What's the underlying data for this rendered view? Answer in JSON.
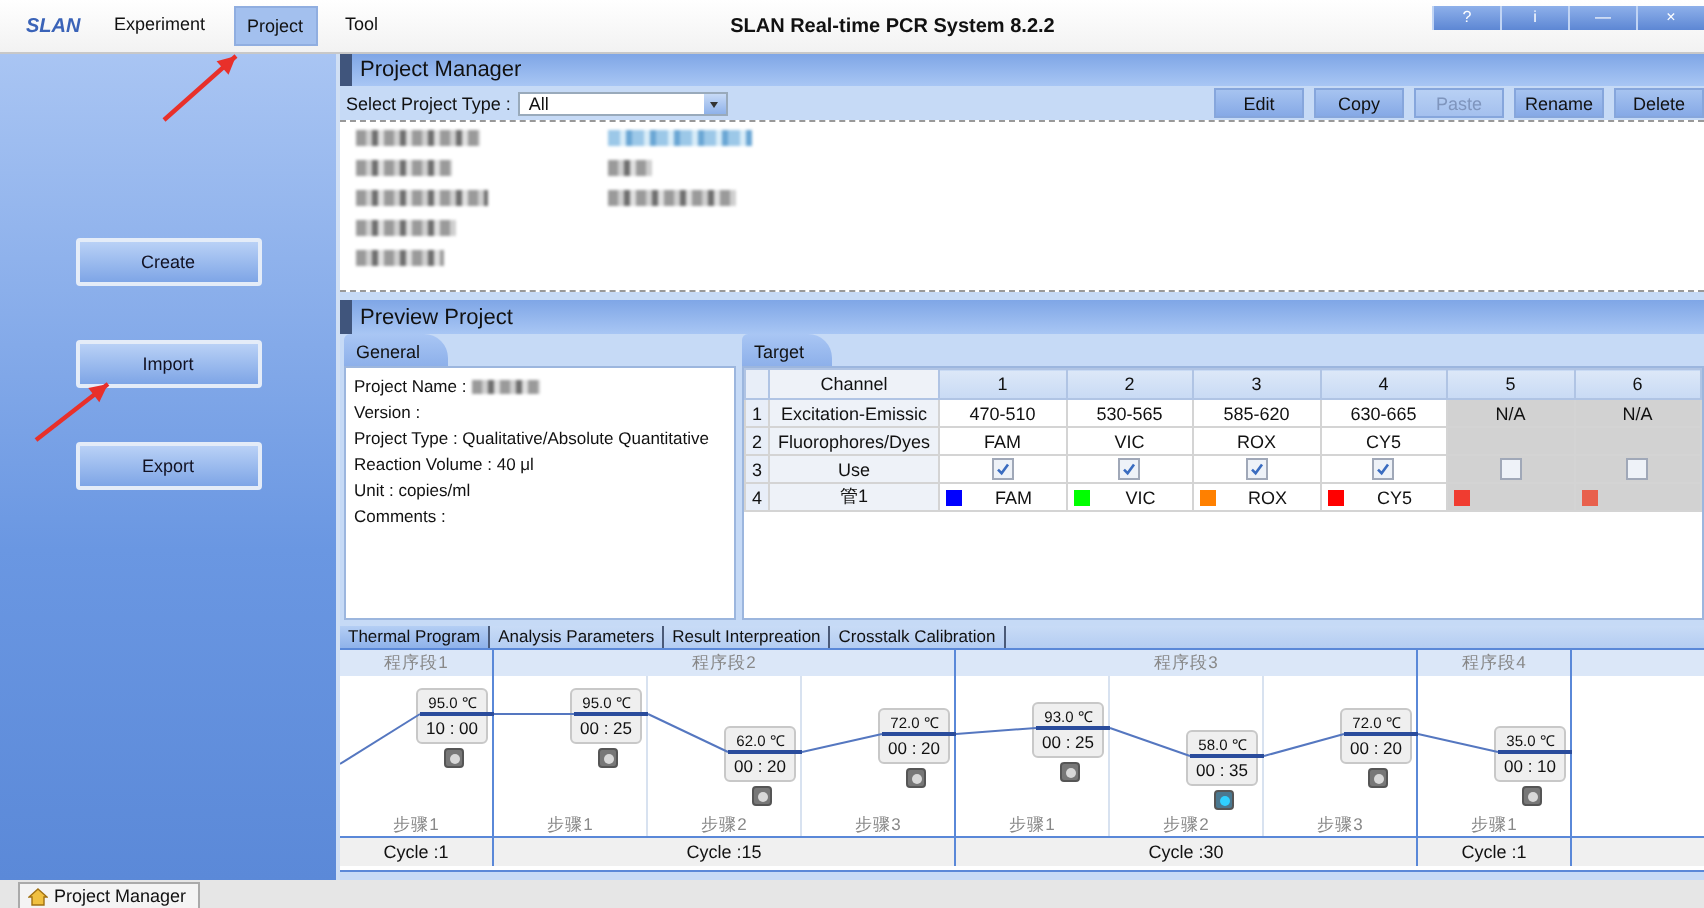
{
  "app": {
    "logo": "SLAN",
    "title": "SLAN Real-time PCR System 8.2.2"
  },
  "menu": [
    {
      "label": "Experiment",
      "selected": false
    },
    {
      "label": "Project",
      "selected": true
    },
    {
      "label": "Tool",
      "selected": false
    }
  ],
  "window_buttons": [
    "?",
    "i",
    "—",
    "×"
  ],
  "sidebar": {
    "buttons": [
      "Create",
      "Import",
      "Export"
    ]
  },
  "project_manager": {
    "title": "Project Manager",
    "type_label": "Select Project Type :",
    "type_value": "All",
    "actions": [
      {
        "label": "Edit",
        "disabled": false
      },
      {
        "label": "Copy",
        "disabled": false
      },
      {
        "label": "Paste",
        "disabled": true
      },
      {
        "label": "Rename",
        "disabled": false
      },
      {
        "label": "Delete",
        "disabled": false
      }
    ],
    "project_list": {
      "kind": "blurred"
    }
  },
  "preview": {
    "title": "Preview Project",
    "general": {
      "tab": "General",
      "project_name": {
        "kind": "blurred"
      },
      "lines": [
        "Project Name :",
        "Version :",
        "Project Type : Qualitative/Absolute Quantitative",
        "Reaction Volume : 40 μl",
        "Unit : copies/ml",
        "Comments :"
      ]
    },
    "target": {
      "tab": "Target",
      "channel_header": "Channel",
      "columns": [
        {
          "label": "1",
          "disabled": false
        },
        {
          "label": "2",
          "disabled": false
        },
        {
          "label": "3",
          "disabled": false
        },
        {
          "label": "4",
          "disabled": false
        },
        {
          "label": "5",
          "disabled": true
        },
        {
          "label": "6",
          "disabled": true
        }
      ],
      "rows": [
        {
          "index": "1",
          "label": "Excitation-Emissic",
          "kind": "text",
          "cells": [
            "470-510",
            "530-565",
            "585-620",
            "630-665",
            "N/A",
            "N/A"
          ]
        },
        {
          "index": "2",
          "label": "Fluorophores/Dyes",
          "kind": "text",
          "cells": [
            "FAM",
            "VIC",
            "ROX",
            "CY5"
          ]
        },
        {
          "index": "3",
          "label": "Use",
          "kind": "check",
          "cells": [
            {
              "checked": true
            },
            {
              "checked": true
            },
            {
              "checked": true
            },
            {
              "checked": true
            },
            {
              "checked": false
            },
            {
              "checked": false
            }
          ]
        },
        {
          "index": "4",
          "label": "管1",
          "kind": "dye",
          "cells": [
            {
              "color": "#0000ff",
              "text": "FAM"
            },
            {
              "color": "#00ff00",
              "text": "VIC"
            },
            {
              "color": "#ff8000",
              "text": "ROX"
            },
            {
              "color": "#ff0000",
              "text": "CY5"
            },
            {
              "color": "#f03c30"
            },
            {
              "color": "#e8604c"
            }
          ]
        }
      ]
    }
  },
  "bottom_tabs": [
    {
      "label": "Thermal Program",
      "selected": true
    },
    {
      "label": "Analysis Parameters",
      "selected": false
    },
    {
      "label": "Result Interpreation",
      "selected": false
    },
    {
      "label": "Crosstalk Calibration",
      "selected": false
    }
  ],
  "program": {
    "stages": [
      {
        "label": "程序段1",
        "cycle": "Cycle :1",
        "steps": [
          {
            "label": "步骤1",
            "temperature": "95.0 ℃",
            "time": "10 : 00",
            "level": 0.76,
            "collect": false
          }
        ]
      },
      {
        "label": "程序段2",
        "cycle": "Cycle :15",
        "steps": [
          {
            "label": "步骤1",
            "temperature": "95.0 ℃",
            "time": "00 : 25",
            "level": 0.76,
            "collect": false
          },
          {
            "label": "步骤2",
            "temperature": "62.0 ℃",
            "time": "00 : 20",
            "level": 0.53,
            "collect": false
          },
          {
            "label": "步骤3",
            "temperature": "72.0 ℃",
            "time": "00 : 20",
            "level": 0.64,
            "collect": false
          }
        ]
      },
      {
        "label": "程序段3",
        "cycle": "Cycle :30",
        "steps": [
          {
            "label": "步骤1",
            "temperature": "93.0 ℃",
            "time": "00 : 25",
            "level": 0.68,
            "collect": false
          },
          {
            "label": "步骤2",
            "temperature": "58.0 ℃",
            "time": "00 : 35",
            "level": 0.5,
            "collect": true
          },
          {
            "label": "步骤3",
            "temperature": "72.0 ℃",
            "time": "00 : 20",
            "level": 0.64,
            "collect": false
          }
        ]
      },
      {
        "label": "程序段4",
        "cycle": "Cycle :1",
        "steps": [
          {
            "label": "步骤1",
            "temperature": "35.0 ℃",
            "time": "00 : 10",
            "level": 0.53,
            "collect": false
          }
        ]
      }
    ]
  },
  "status_bar": {
    "tab": "Project Manager"
  }
}
